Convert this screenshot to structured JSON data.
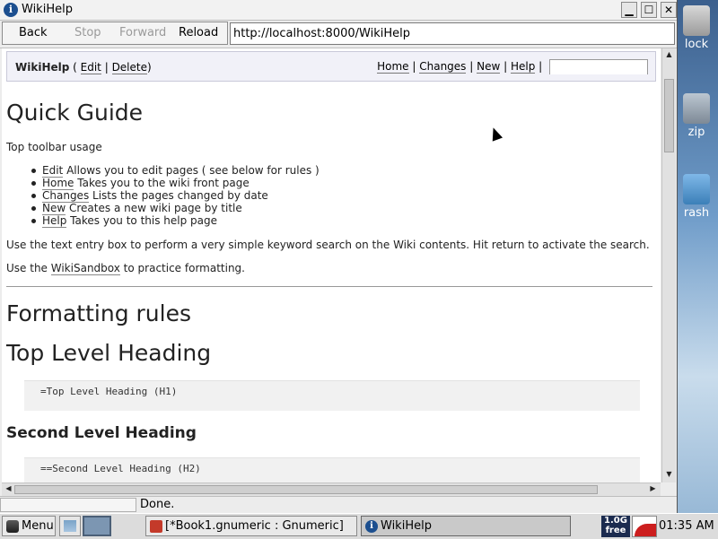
{
  "desktop": {
    "icons": [
      {
        "label": "lock",
        "icon": "lock-icon"
      },
      {
        "label": "zip",
        "icon": "zip-icon"
      },
      {
        "label": "rash",
        "icon": "trash-icon"
      }
    ]
  },
  "window": {
    "title": "WikiHelp",
    "controls": {
      "minimize": "▁",
      "maximize": "☐",
      "close": "✕"
    }
  },
  "navbar": {
    "back": "Back",
    "stop": "Stop",
    "forward": "Forward",
    "reload": "Reload",
    "url": "http://localhost:8000/WikiHelp"
  },
  "wikibar": {
    "page_name": "WikiHelp",
    "open_paren": " ( ",
    "edit": "Edit",
    "sep": " | ",
    "delete": "Delete",
    "close_paren": ")",
    "home": "Home",
    "changes": "Changes",
    "new": "New",
    "help": "Help",
    "search_value": ""
  },
  "page": {
    "title": "Quick Guide",
    "intro": "Top toolbar usage",
    "bullets": [
      {
        "link": "Edit",
        "text": " Allows you to edit pages ( see below for rules )"
      },
      {
        "link": "Home",
        "text": " Takes you to the wiki front page"
      },
      {
        "link": "Changes",
        "text": " Lists the pages changed by date"
      },
      {
        "link": "New",
        "text": " Creates a new wiki page by title"
      },
      {
        "link": "Help",
        "text": " Takes you to this help page"
      }
    ],
    "search_note": "Use the text entry box to perform a very simple keyword search on the Wiki contents. Hit return to activate the search.",
    "sandbox_pre": "Use the ",
    "sandbox_link": "WikiSandbox",
    "sandbox_post": " to practice formatting.",
    "formatting_title": "Formatting rules",
    "h1_example_title": "Top Level Heading",
    "h1_example_code": "=Top Level Heading (H1)",
    "h2_example_title": "Second Level Heading",
    "h2_example_code": "==Second Level Heading (H2)"
  },
  "status": {
    "text": "Done."
  },
  "taskbar": {
    "menu": "Menu",
    "tasks": [
      {
        "label": "[*Book1.gnumeric : Gnumeric]",
        "icon": "gnumeric-icon"
      },
      {
        "label": "WikiHelp",
        "icon": "info-icon"
      }
    ],
    "mem_line1": "1.0G",
    "mem_line2": "free",
    "clock": "01:35 AM"
  }
}
